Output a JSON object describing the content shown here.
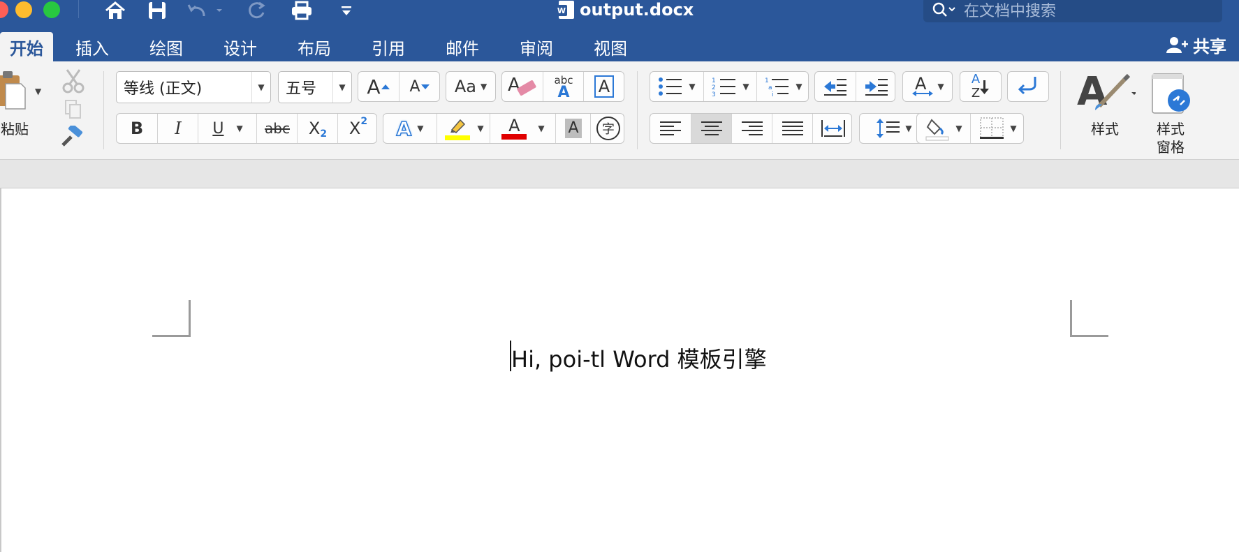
{
  "window": {
    "title": "output.docx",
    "search_placeholder": "在文档中搜索"
  },
  "tabs": [
    {
      "label": "开始",
      "active": true
    },
    {
      "label": "插入"
    },
    {
      "label": "绘图"
    },
    {
      "label": "设计"
    },
    {
      "label": "布局"
    },
    {
      "label": "引用"
    },
    {
      "label": "邮件"
    },
    {
      "label": "审阅"
    },
    {
      "label": "视图"
    }
  ],
  "share_label": "共享",
  "ribbon": {
    "paste_label": "粘贴",
    "font_name": "等线 (正文)",
    "font_size": "五号",
    "styles_label": "样式",
    "styles_pane_label_1": "样式",
    "styles_pane_label_2": "窗格",
    "bold": "B",
    "italic": "I",
    "underline": "U",
    "strike": "abc",
    "subscript_base": "X",
    "subscript_mark": "2",
    "superscript_base": "X",
    "superscript_mark": "2",
    "grow_font": "A",
    "shrink_font": "A",
    "change_case": "Aa",
    "spelling_top": "abc",
    "spelling_bottom": "A",
    "char_border": "A",
    "text_effects": "A",
    "font_color": "A",
    "char_shading": "A",
    "phonetic": "字",
    "sort_a": "A",
    "sort_z": "Z",
    "highlight_color": "#ffff00",
    "font_color_value": "#e00000"
  },
  "document": {
    "text": "Hi, poi-tl Word 模板引擎"
  }
}
